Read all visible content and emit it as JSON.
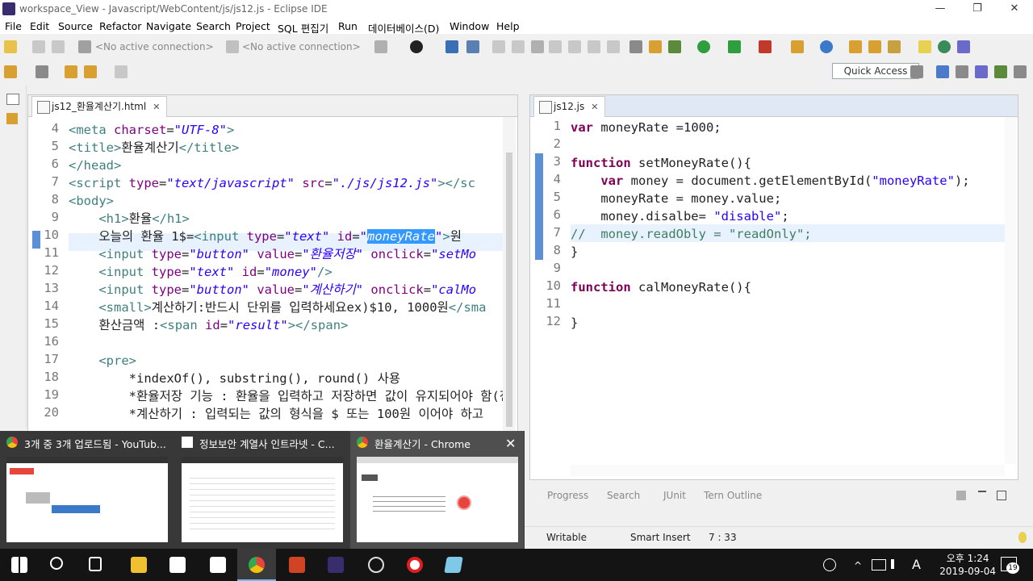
{
  "window": {
    "title": "workspace_View - Javascript/WebContent/js/js12.js - Eclipse IDE",
    "minimize": "—",
    "restore": "❐",
    "close": "✕"
  },
  "menu": [
    "File",
    "Edit",
    "Source",
    "Refactor",
    "Navigate",
    "Search",
    "Project",
    "SQL 편집기",
    "Run",
    "데이터베이스(D)",
    "Window",
    "Help"
  ],
  "toolbar": {
    "connection1": "<No active connection>",
    "connection2": "<No active connection>",
    "quick_access": "Quick Access"
  },
  "left_editor": {
    "tab": "js12_환율계산기.html",
    "tab_close": "✕",
    "lines": [
      {
        "n": "4",
        "html": "<span class=\"tag\">&lt;meta </span><span class=\"attr\">charset</span>=<span class=\"str\">\"UTF-8\"</span><span class=\"tag\">&gt;</span>"
      },
      {
        "n": "5",
        "html": "<span class=\"tag\">&lt;title&gt;</span>환율계산기<span class=\"tag\">&lt;/title&gt;</span>"
      },
      {
        "n": "6",
        "html": "<span class=\"tag\">&lt;/head&gt;</span>"
      },
      {
        "n": "7",
        "html": "<span class=\"tag\">&lt;script </span><span class=\"attr\">type</span>=<span class=\"str\">\"text/javascript\"</span> <span class=\"attr\">src</span>=<span class=\"str\">\"./js/js12.js\"</span><span class=\"tag\">&gt;&lt;/sc</span>"
      },
      {
        "n": "8",
        "html": "<span class=\"tag\">&lt;body&gt;</span>"
      },
      {
        "n": "9",
        "html": "    <span class=\"tag\">&lt;h1&gt;</span>환율<span class=\"tag\">&lt;/h1&gt;</span>"
      },
      {
        "n": "10",
        "html": "    오늘의 환율 1$=<span class=\"tag\">&lt;input </span><span class=\"attr\">type</span>=<span class=\"str\">\"text\"</span> <span class=\"attr\">id</span>=<span class=\"str\">\"<span class=\"sel\">moneyRate</span>\"</span><span class=\"tag\">&gt;</span>원"
      },
      {
        "n": "11",
        "html": "    <span class=\"tag\">&lt;input </span><span class=\"attr\">type</span>=<span class=\"str\">\"button\"</span> <span class=\"attr\">value</span>=<span class=\"str\">\"환율저장\"</span> <span class=\"attr\">onclick</span>=<span class=\"str\">\"setMo</span>"
      },
      {
        "n": "12",
        "html": "    <span class=\"tag\">&lt;input </span><span class=\"attr\">type</span>=<span class=\"str\">\"text\"</span> <span class=\"attr\">id</span>=<span class=\"str\">\"money\"</span><span class=\"tag\">/&gt;</span>"
      },
      {
        "n": "13",
        "html": "    <span class=\"tag\">&lt;input </span><span class=\"attr\">type</span>=<span class=\"str\">\"button\"</span> <span class=\"attr\">value</span>=<span class=\"str\">\"계산하기\"</span> <span class=\"attr\">onclick</span>=<span class=\"str\">\"calMo</span>"
      },
      {
        "n": "14",
        "html": "    <span class=\"tag\">&lt;small&gt;</span>계산하기:반드시 단위를 입력하세요ex)$10, 1000원<span class=\"tag\">&lt;/sma</span>"
      },
      {
        "n": "15",
        "html": "    환산금액 :<span class=\"tag\">&lt;span </span><span class=\"attr\">id</span>=<span class=\"str\">\"result\"</span><span class=\"tag\">&gt;&lt;/span&gt;</span>"
      },
      {
        "n": "16",
        "html": ""
      },
      {
        "n": "17",
        "html": "    <span class=\"tag\">&lt;pre&gt;</span>"
      },
      {
        "n": "18",
        "html": "        *indexOf(), substring(), round() 사용"
      },
      {
        "n": "19",
        "html": "        *환율저장 기능 : 환율을 입력하고 저장하면 값이 유지되어야 함(전"
      },
      {
        "n": "20",
        "html": "        *계산하기 : 입력되는 값의 형식을 $ 또는 100원 이어야 하고"
      }
    ]
  },
  "right_editor": {
    "tab": "js12.js",
    "tab_close": "✕",
    "lines": [
      {
        "n": "1",
        "html": "<span class=\"kw\">var</span> moneyRate =1000;"
      },
      {
        "n": "2",
        "html": ""
      },
      {
        "n": "3",
        "html": "<span class=\"kw\">function</span> setMoneyRate(){"
      },
      {
        "n": "4",
        "html": "    <span class=\"kw\">var</span> money = document.getElementById(<span class=\"jstr\">\"moneyRate\"</span>);"
      },
      {
        "n": "5",
        "html": "    moneyRate = money.value;"
      },
      {
        "n": "6",
        "html": "    money.disalbe= <span class=\"jstr\">\"disable\"</span>;"
      },
      {
        "n": "7",
        "html": "<span class=\"cmt\">//  money.readObly = \"readOnly\";</span>"
      },
      {
        "n": "8",
        "html": "}"
      },
      {
        "n": "9",
        "html": ""
      },
      {
        "n": "10",
        "html": "<span class=\"kw\">function</span> calMoneyRate(){"
      },
      {
        "n": "11",
        "html": ""
      },
      {
        "n": "12",
        "html": "}"
      }
    ]
  },
  "bottom_tabs": [
    "Progress",
    "Search",
    "JUnit",
    "Tern Outline"
  ],
  "status": {
    "mode": "Writable",
    "insert": "Smart Insert",
    "position": "7 : 33"
  },
  "previews": [
    {
      "title": "3개 중 3개 업로드됨 - YouTub...",
      "color": "#e8453c"
    },
    {
      "title": "정보보안 계열사 인트라넷 - C...",
      "color": "#ffffff"
    },
    {
      "title": "환율계산기 - Chrome",
      "color": "#e8453c"
    }
  ],
  "preview_close": "✕",
  "clock": {
    "time": "오후 1:24",
    "date": "2019-09-04"
  },
  "notifications": "19",
  "tray_ime": "A",
  "colors": {
    "accent": "#3399ff",
    "keyword": "#7f0055",
    "string": "#2a00ff",
    "tag": "#3f7f7f",
    "attr": "#7f007f",
    "comment": "#3f7f5f"
  }
}
